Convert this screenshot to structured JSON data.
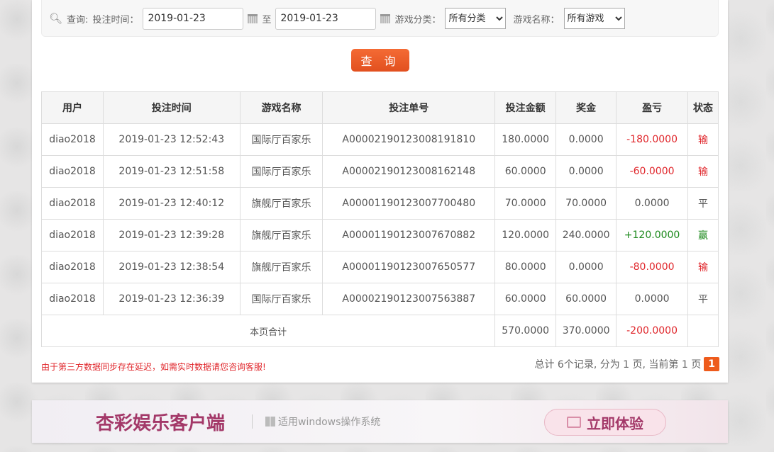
{
  "filter": {
    "query_label": "查询:",
    "time_label": "投注时间：",
    "start_date": "2019-01-23",
    "to": "至",
    "end_date": "2019-01-23",
    "category_label": "游戏分类：",
    "category_value": "所有分类",
    "game_label": "游戏名称：",
    "game_value": "所有游戏",
    "search_button": "查 询"
  },
  "table": {
    "headers": [
      "用户",
      "投注时间",
      "游戏名称",
      "投注单号",
      "投注金额",
      "奖金",
      "盈亏",
      "状态"
    ],
    "rows": [
      [
        "diao2018",
        "2019-01-23 12:52:43",
        "国际厅百家乐",
        "A00002190123008191810",
        "180.0000",
        "0.0000",
        "-180.0000",
        "输"
      ],
      [
        "diao2018",
        "2019-01-23 12:51:58",
        "国际厅百家乐",
        "A00002190123008162148",
        "60.0000",
        "0.0000",
        "-60.0000",
        "输"
      ],
      [
        "diao2018",
        "2019-01-23 12:40:12",
        "旗舰厅百家乐",
        "A00001190123007700480",
        "70.0000",
        "70.0000",
        "0.0000",
        "平"
      ],
      [
        "diao2018",
        "2019-01-23 12:39:28",
        "旗舰厅百家乐",
        "A00001190123007670882",
        "120.0000",
        "240.0000",
        "+120.0000",
        "赢"
      ],
      [
        "diao2018",
        "2019-01-23 12:38:54",
        "旗舰厅百家乐",
        "A00001190123007650577",
        "80.0000",
        "0.0000",
        "-80.0000",
        "输"
      ],
      [
        "diao2018",
        "2019-01-23 12:36:39",
        "国际厅百家乐",
        "A00002190123007563887",
        "60.0000",
        "60.0000",
        "0.0000",
        "平"
      ]
    ],
    "total": {
      "label": "本页合计",
      "amount": "570.0000",
      "bonus": "370.0000",
      "profit": "-200.0000"
    }
  },
  "note": "由于第三方数据同步存在延迟，如需实时数据请您咨询客服!",
  "pager": {
    "summary": "总计 6个记录, 分为 1 页, 当前第 1 页",
    "current": "1"
  },
  "banner": {
    "title": "杏彩娱乐客户端",
    "subtitle": "适用windows操作系统",
    "button": "立即体验"
  }
}
